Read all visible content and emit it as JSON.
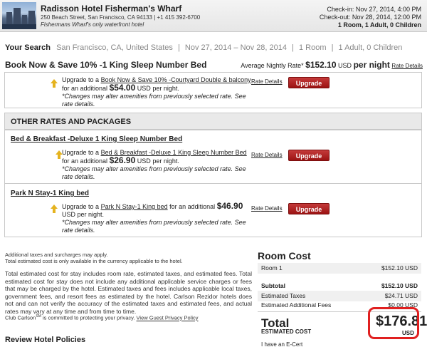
{
  "header": {
    "hotel_name": "Radisson Hotel Fisherman's Wharf",
    "address": "250 Beach Street, San Francisco, CA 94133 | +1 415 392-6700",
    "tagline": "Fishermans Wharf's only waterfront hotel",
    "checkin": "Check-in: Nov 27, 2014, 4:00 PM",
    "checkout": "Check-out: Nov 28, 2014, 12:00 PM",
    "occupancy": "1 Room, 1 Adult, 0 Children"
  },
  "search": {
    "label": "Your Search",
    "location": "San Francisco, CA, United States",
    "dates": "Nov 27, 2014 – Nov 28, 2014",
    "rooms": "1 Room",
    "guests": "1 Adult, 0 Children",
    "sep": "|"
  },
  "selected_rate": {
    "title": "Book Now & Save 10% -1 King Sleep Number Bed",
    "avg_label": "Average Nightly Rate*",
    "avg_amount": "$152.10",
    "currency": "USD",
    "per_night": "per night",
    "rate_details": "Rate Details"
  },
  "upgrades_top": {
    "prefix": "Upgrade to a",
    "link": "Book Now & Save 10% -Courtyard Double & balcony",
    "for": "for an additional",
    "price": "$54.00",
    "currency": "USD",
    "suffix": "per night.",
    "note": "*Changes may alter amenities from previously selected rate. See rate details.",
    "rate_details": "Rate Details",
    "button": "Upgrade Now"
  },
  "other_rates": {
    "heading": "OTHER RATES AND PACKAGES",
    "packages": [
      {
        "title": "Bed & Breakfast -Deluxe 1 King Sleep Number Bed",
        "prefix": "Upgrade to a",
        "link": "Bed & Breakfast -Deluxe 1 King Sleep Number Bed",
        "for": "for an additional",
        "price": "$26.90",
        "currency": "USD",
        "suffix": "per night.",
        "note": "*Changes may alter amenities from previously selected rate. See rate details.",
        "rate_details": "Rate Details",
        "button": "Upgrade Now"
      },
      {
        "title": "Park N Stay-1 King bed",
        "prefix": "Upgrade to a",
        "link": "Park N Stay-1 King bed",
        "for": "for an additional",
        "price": "$46.90",
        "currency": "USD",
        "suffix": "per night.",
        "note": "*Changes may alter amenities from previously selected rate. See rate details.",
        "rate_details": "Rate Details",
        "button": "Upgrade Now"
      }
    ]
  },
  "disclaimer": {
    "line1": "Additional taxes and surcharges may apply.",
    "line2": "Total estimated cost is only available in the currency applicable to the hotel.",
    "paragraph": "Total estimated cost for stay includes room rate, estimated taxes, and estimated fees. Total estimated cost for stay does not include any additional applicable service charges or fees that may be charged by the hotel. Estimated taxes and fees includes applicable local taxes, government fees, and resort fees as estimated by the hotel. Carlson Rezidor hotels does not and can not verify the accuracy of the estimated taxes and estimated fees, and actual rates may vary at any time and from time to time.",
    "privacy_prefix": "Club Carlson",
    "privacy_sm": "SM",
    "privacy_mid": "is committed to protecting your privacy.",
    "privacy_link": "View Guest Privacy Policy",
    "review": "Review Hotel Policies"
  },
  "room_cost": {
    "heading": "Room Cost",
    "rows": [
      {
        "label": "Room 1",
        "value": "$152.10 USD"
      },
      {
        "label": "Subtotal",
        "value": "$152.10 USD"
      },
      {
        "label": "Estimated Taxes",
        "value": "$24.71 USD"
      },
      {
        "label": "Estimated Additional Fees",
        "value": "$0.00 USD"
      }
    ],
    "total_label": "Total",
    "estimated_label": "ESTIMATED COST",
    "total_amount": "$176.81",
    "total_currency": "USD",
    "ecert": "I have an E-Cert"
  },
  "colors": {
    "upgrade_button": "#b01f1f",
    "highlight_ring": "#e02020",
    "arrow": "#e5b31f"
  }
}
